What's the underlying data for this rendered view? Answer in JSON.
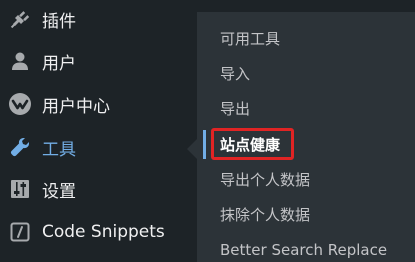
{
  "sidebar": {
    "items": [
      {
        "label": "插件",
        "icon": "plugin-icon"
      },
      {
        "label": "用户",
        "icon": "user-icon"
      },
      {
        "label": "用户中心",
        "icon": "user-center-icon"
      },
      {
        "label": "工具",
        "icon": "wrench-icon",
        "active": true
      },
      {
        "label": "设置",
        "icon": "settings-sliders-icon"
      },
      {
        "label": "Code Snippets",
        "icon": "code-snippets-icon"
      }
    ]
  },
  "tools_submenu": {
    "items": [
      {
        "label": "可用工具"
      },
      {
        "label": "导入"
      },
      {
        "label": "导出"
      },
      {
        "label": "站点健康",
        "current": true
      },
      {
        "label": "导出个人数据"
      },
      {
        "label": "抹除个人数据"
      },
      {
        "label": "Better Search Replace"
      }
    ]
  },
  "colors": {
    "sidebar_bg": "#1d2327",
    "submenu_bg": "#2c3338",
    "active_accent": "#72aee6",
    "highlight_border": "#e02424"
  }
}
